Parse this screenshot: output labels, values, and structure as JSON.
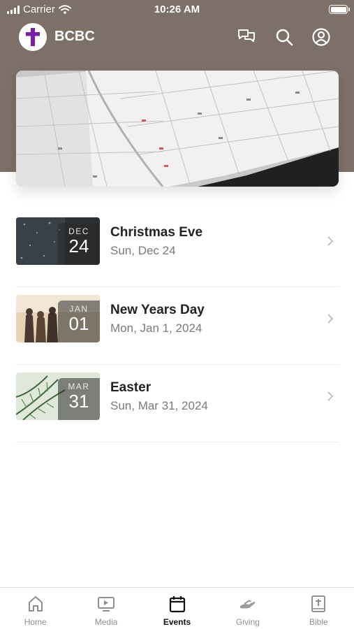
{
  "status_bar": {
    "carrier": "Carrier",
    "time": "10:26 AM"
  },
  "app_bar": {
    "title": "BCBC",
    "logo_icon": "cross-logo-icon",
    "actions": [
      "chat-icon",
      "search-icon",
      "account-icon"
    ],
    "brand_color": "#7d1ea8"
  },
  "hero": {
    "image": "calendar-planner-photo"
  },
  "events": [
    {
      "title": "Christmas Eve",
      "date": "Sun, Dec 24",
      "badge_month": "DEC",
      "badge_day": "24",
      "thumbnail": "snowy-night-photo"
    },
    {
      "title": "New Years Day",
      "date": "Mon, Jan 1, 2024",
      "badge_month": "JAN",
      "badge_day": "01",
      "thumbnail": "people-sunset-photo"
    },
    {
      "title": "Easter",
      "date": "Sun, Mar 31, 2024",
      "badge_month": "MAR",
      "badge_day": "31",
      "thumbnail": "palm-leaves-photo"
    }
  ],
  "tab_bar": {
    "active": "Events",
    "tabs": [
      {
        "label": "Home",
        "icon": "home-icon"
      },
      {
        "label": "Media",
        "icon": "media-icon"
      },
      {
        "label": "Events",
        "icon": "calendar-icon"
      },
      {
        "label": "Giving",
        "icon": "giving-hand-icon"
      },
      {
        "label": "Bible",
        "icon": "bible-icon"
      }
    ]
  },
  "colors": {
    "header_background": "#7c7068",
    "active_tab": "#111111",
    "inactive_tab": "#8e8e8e"
  }
}
